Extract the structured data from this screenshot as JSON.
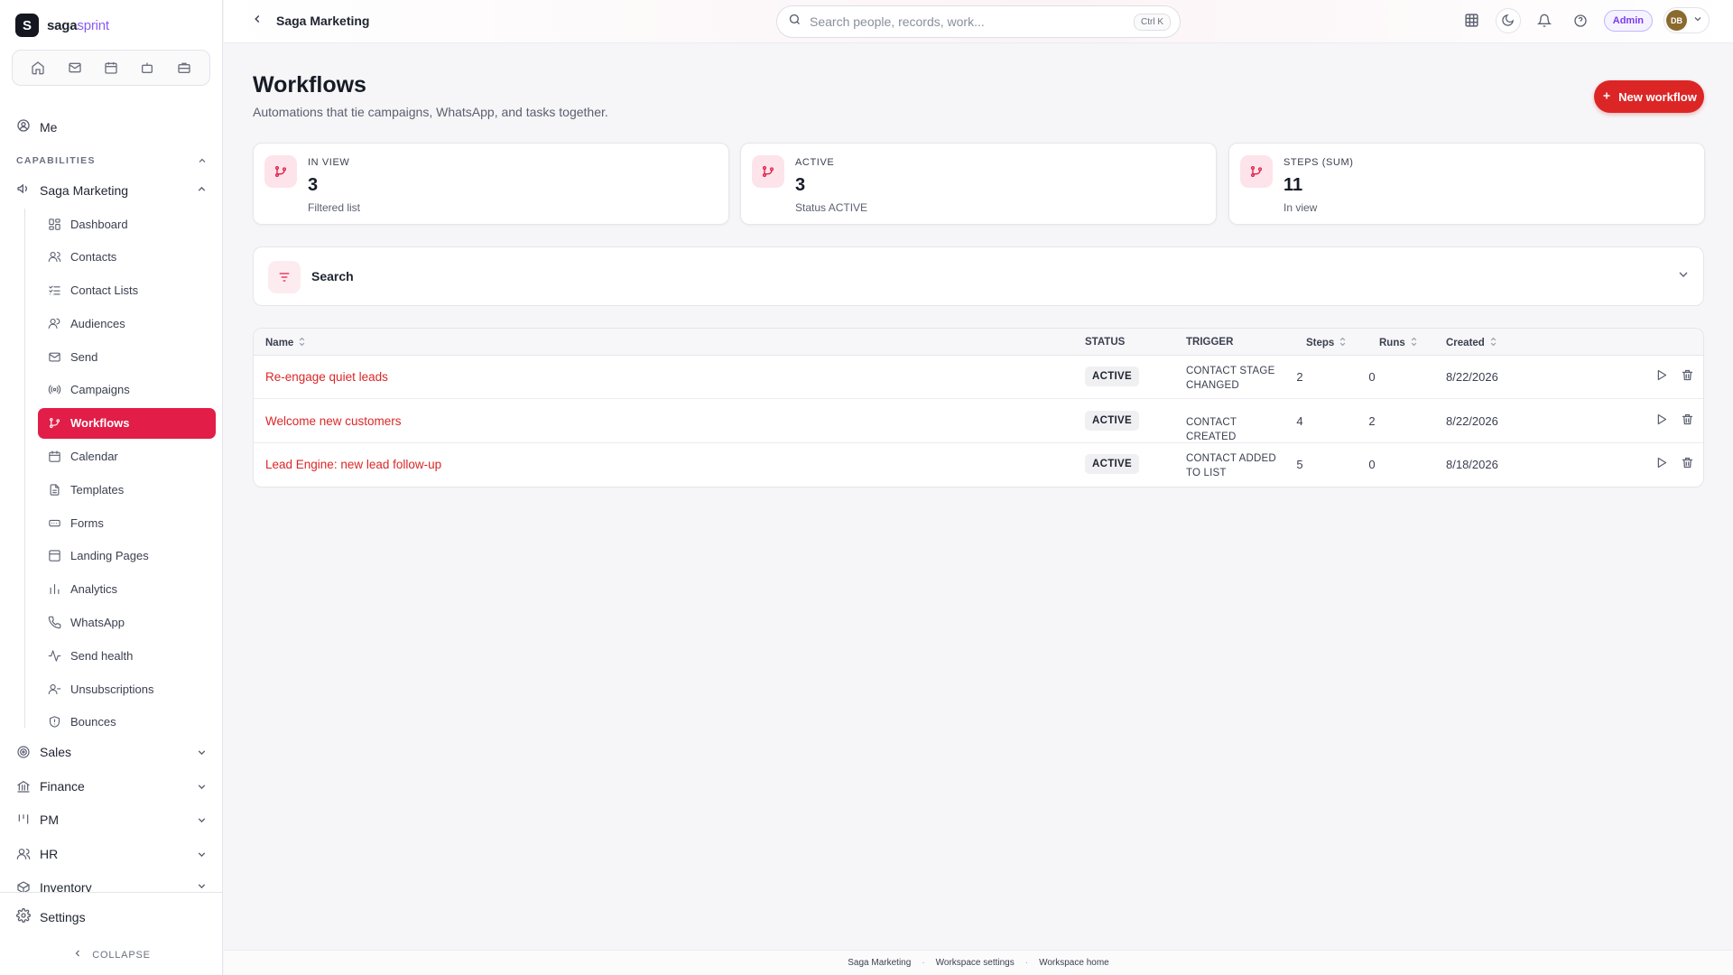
{
  "brand": {
    "logo_letter": "S",
    "name_main": "saga",
    "name_accent": "sprint"
  },
  "quickbar": [
    {
      "icon": "home-icon"
    },
    {
      "icon": "mail-icon"
    },
    {
      "icon": "calendar-icon"
    },
    {
      "icon": "bot-icon"
    },
    {
      "icon": "briefcase-icon"
    }
  ],
  "sidebar": {
    "me_label": "Me",
    "capabilities_label": "CAPABILITIES",
    "marketing_label": "Saga Marketing",
    "marketing_items": [
      {
        "label": "Dashboard",
        "icon": "dashboard-icon"
      },
      {
        "label": "Contacts",
        "icon": "contacts-icon"
      },
      {
        "label": "Contact Lists",
        "icon": "list-check-icon"
      },
      {
        "label": "Audiences",
        "icon": "audiences-icon"
      },
      {
        "label": "Send",
        "icon": "mail-icon"
      },
      {
        "label": "Campaigns",
        "icon": "broadcast-icon"
      },
      {
        "label": "Workflows",
        "icon": "git-branch-icon",
        "active": true
      },
      {
        "label": "Calendar",
        "icon": "calendar-icon"
      },
      {
        "label": "Templates",
        "icon": "file-text-icon"
      },
      {
        "label": "Forms",
        "icon": "form-icon"
      },
      {
        "label": "Landing Pages",
        "icon": "layout-icon"
      },
      {
        "label": "Analytics",
        "icon": "bar-chart-icon"
      },
      {
        "label": "WhatsApp",
        "icon": "phone-icon"
      },
      {
        "label": "Send health",
        "icon": "activity-icon"
      },
      {
        "label": "Unsubscriptions",
        "icon": "user-minus-icon"
      },
      {
        "label": "Bounces",
        "icon": "shield-icon"
      }
    ],
    "groups": [
      {
        "label": "Sales",
        "icon": "target-icon"
      },
      {
        "label": "Finance",
        "icon": "bank-icon"
      },
      {
        "label": "PM",
        "icon": "kanban-icon"
      },
      {
        "label": "HR",
        "icon": "users-icon"
      },
      {
        "label": "Inventory",
        "icon": "box-icon"
      }
    ],
    "settings_label": "Settings",
    "collapse_label": "COLLAPSE"
  },
  "topbar": {
    "crumb": "Saga Marketing",
    "search_placeholder": "Search people, records, work...",
    "search_shortcut": "Ctrl K",
    "admin_label": "Admin",
    "avatar_initials": "DB"
  },
  "page": {
    "title": "Workflows",
    "subtitle": "Automations that tie campaigns, WhatsApp, and tasks together.",
    "new_button": "New workflow"
  },
  "stats": [
    {
      "label": "IN VIEW",
      "value": "3",
      "note": "Filtered list"
    },
    {
      "label": "ACTIVE",
      "value": "3",
      "note": "Status ACTIVE"
    },
    {
      "label": "STEPS (SUM)",
      "value": "11",
      "note": "In view"
    }
  ],
  "filter": {
    "label": "Search"
  },
  "table": {
    "columns": {
      "name": "Name",
      "status": "STATUS",
      "trigger": "TRIGGER",
      "steps": "Steps",
      "runs": "Runs",
      "created": "Created"
    },
    "rows": [
      {
        "name": "Re-engage quiet leads",
        "status": "ACTIVE",
        "trigger_l1": "CONTACT STAGE",
        "trigger_l2": "CHANGED",
        "steps": "2",
        "runs": "0",
        "created": "8/22/2026"
      },
      {
        "name": "Welcome new customers",
        "status": "ACTIVE",
        "trigger_l1": "CONTACT CREATED",
        "trigger_l2": "",
        "steps": "4",
        "runs": "2",
        "created": "8/22/2026"
      },
      {
        "name": "Lead Engine: new lead follow-up",
        "status": "ACTIVE",
        "trigger_l1": "CONTACT ADDED",
        "trigger_l2": "TO LIST",
        "steps": "5",
        "runs": "0",
        "created": "8/18/2026"
      }
    ]
  },
  "footer": {
    "links": [
      "Saga Marketing",
      "Workspace settings",
      "Workspace home"
    ],
    "separator": "·"
  },
  "colors": {
    "accent": "#e11d48",
    "primary_button": "#dc2626",
    "admin": "#7c3aed"
  }
}
